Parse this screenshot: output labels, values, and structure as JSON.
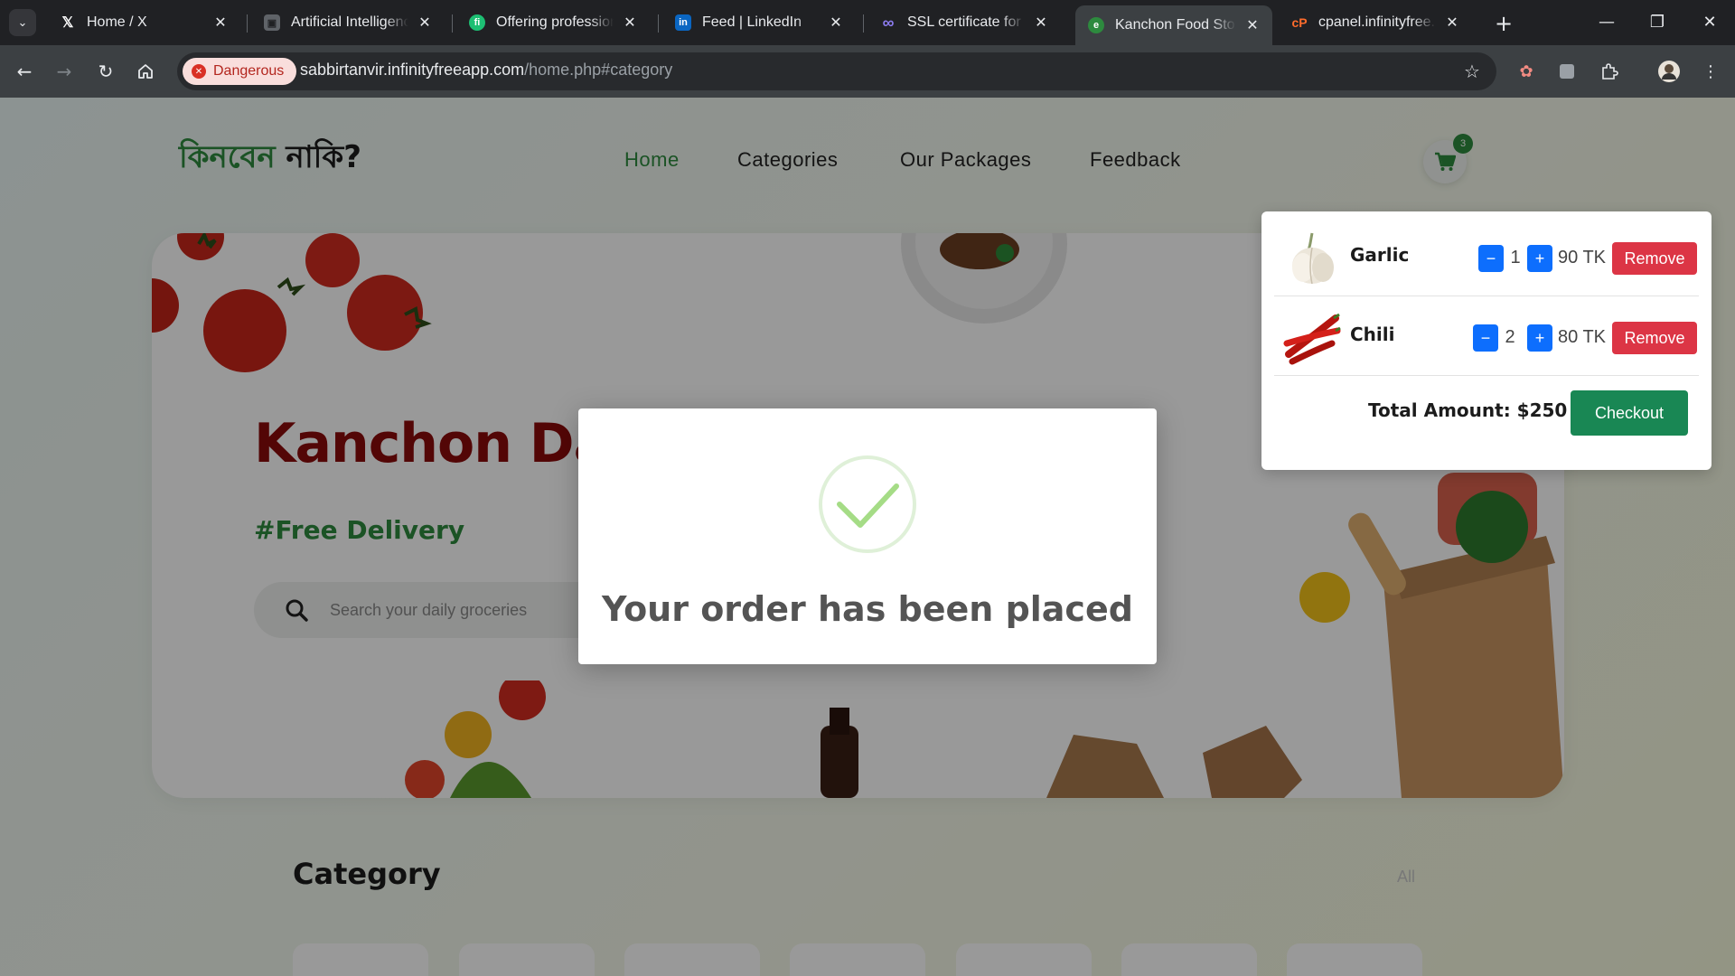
{
  "browser": {
    "tabs": [
      {
        "title": "Home / X",
        "icon": "x-logo-icon"
      },
      {
        "title": "Artificial Intelligence",
        "icon": "profile-card-icon"
      },
      {
        "title": "Offering professional",
        "icon": "fiverr-logo-icon"
      },
      {
        "title": "Feed | LinkedIn",
        "icon": "linkedin-logo-icon"
      },
      {
        "title": "SSL certificate for sal",
        "icon": "infinity-icon"
      },
      {
        "title": "Kanchon Food Store",
        "icon": "site-favicon-icon",
        "active": true
      },
      {
        "title": "cpanel.infinityfree.co",
        "icon": "cpanel-logo-icon"
      }
    ],
    "security_chip": "Dangerous",
    "url_host": "sabbirtanvir.infinityfreeapp.com",
    "url_path": "/home.php#category"
  },
  "site": {
    "logo_green": "কিনবেন",
    "logo_dark": "নাকি?",
    "nav": [
      "Home",
      "Categories",
      "Our Packages",
      "Feedback"
    ],
    "active_nav": "Home",
    "cart_count": "3"
  },
  "hero": {
    "title": "Kanchon Da",
    "tagline": "#Free Delivery",
    "search_placeholder": "Search your daily groceries"
  },
  "category_section": {
    "title": "Category",
    "see_all": "All"
  },
  "cart": {
    "items": [
      {
        "name": "Garlic",
        "qty": "1",
        "price": "90 TK",
        "minus": "−",
        "plus": "+",
        "remove": "Remove"
      },
      {
        "name": "Chili",
        "qty": "2",
        "price": "80 TK",
        "minus": "−",
        "plus": "+",
        "remove": "Remove"
      }
    ],
    "total": "Total Amount: $250",
    "checkout": "Checkout"
  },
  "modal": {
    "message": "Your order has been placed"
  },
  "colors": {
    "brand_green": "#2d8a3e",
    "hero_title": "#8b0a0a",
    "danger": "#dc3545",
    "primary": "#0d6efd",
    "success": "#198754"
  }
}
